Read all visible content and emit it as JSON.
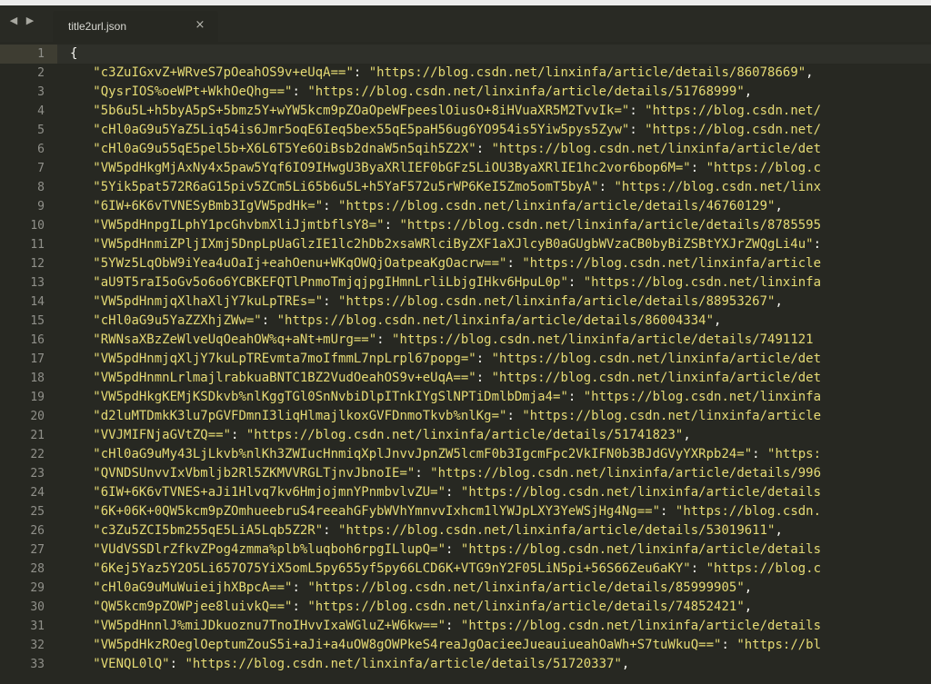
{
  "tabs": [
    {
      "title": "title2url.json"
    }
  ],
  "icons": {
    "nav_back": "◀",
    "nav_forward": "▶",
    "close": "×"
  },
  "colors": {
    "background": "#272822",
    "tabbar": "#292a24",
    "active_line_gutter": "#3e3d32",
    "string": "#e6db74",
    "punctuation": "#f8f8f2",
    "line_number": "#90908a"
  },
  "editor": {
    "first_line": "{",
    "lines": [
      {
        "key": "\"c3ZuIGxvZ+WRveS7pOeahOS9v+eUqA==\"",
        "value": "\"https://blog.csdn.net/linxinfa/article/details/86078669\","
      },
      {
        "key": "\"QysrIOS%oeWPt+WkhOeQhg==\"",
        "value": "\"https://blog.csdn.net/linxinfa/article/details/51768999\","
      },
      {
        "key": "\"5b6u5L+h5byA5pS+5bmz5Y+wYW5kcm9pZOaOpeWFpeeslOiusO+8iHVuaXR5M2TvvIk=\"",
        "value": "\"https://blog.csdn.net/"
      },
      {
        "key": "\"cHl0aG9u5YaZ5Liq54is6Jmr5oqE6Ieq5bex55qE5paH56ug6YO954is5Yiw5pys5Zyw\"",
        "value": "\"https://blog.csdn.net/"
      },
      {
        "key": "\"cHl0aG9u55qE5pel5b+X6L6T5Ye6OiBsb2dnaW5n5qih5Z2X\"",
        "value": "\"https://blog.csdn.net/linxinfa/article/det"
      },
      {
        "key": "\"VW5pdHkgMjAxNy4x5paw5Yqf6IO9IHwgU3ByaXRlIEF0bGFz5LiOU3ByaXRlIE1hc2vor6bop6M=\"",
        "value": "\"https://blog.c"
      },
      {
        "key": "\"5Yik5pat572R6aG15piv5ZCm5Li65b6u5L+h5YaF572u5rWP6KeI5Zmo5omT5byA\"",
        "value": "\"https://blog.csdn.net/linx"
      },
      {
        "key": "\"6IW+6K6vTVNESyBmb3IgVW5pdHk=\"",
        "value": "\"https://blog.csdn.net/linxinfa/article/details/46760129\","
      },
      {
        "key": "\"VW5pdHnpgILphY1pcGhvbmXliJjmtbflsY8=\"",
        "value": "\"https://blog.csdn.net/linxinfa/article/details/8785595"
      },
      {
        "key": "\"VW5pdHnmiZPljIXmj5DnpLpUaGlzIE1lc2hDb2xsaWRlciByZXF1aXJlcyB0aGUgbWVzaCB0byBiZSBtYXJrZWQgLi4u\"",
        "value": ":"
      },
      {
        "key": "\"5YWz5LqObW9iYea4uOaIj+eahOenu+WKqOWQjOatpeaKgOacrw==\"",
        "value": "\"https://blog.csdn.net/linxinfa/article"
      },
      {
        "key": "\"aU9T5raI5oGv5o6o6YCBKEFQTlPnmoTmjqjpgIHmnLrliLbjgIHkv6HpuL0p\"",
        "value": "\"https://blog.csdn.net/linxinfa"
      },
      {
        "key": "\"VW5pdHnmjqXlhaXljY7kuLpTREs=\"",
        "value": "\"https://blog.csdn.net/linxinfa/article/details/88953267\","
      },
      {
        "key": "\"cHl0aG9u5YaZZXhjZWw=\"",
        "value": "\"https://blog.csdn.net/linxinfa/article/details/86004334\","
      },
      {
        "key": "\"RWNsaXBzZeWlveUqOeahOW%q+aNt+mUrg==\"",
        "value": "\"https://blog.csdn.net/linxinfa/article/details/7491121"
      },
      {
        "key": "\"VW5pdHnmjqXljY7kuLpTREvmta7moIfmmL7npLrpl67popg=\"",
        "value": "\"https://blog.csdn.net/linxinfa/article/det"
      },
      {
        "key": "\"VW5pdHnmnLrlmajlrabkuaBNTC1BZ2VudOeahOS9v+eUqA==\"",
        "value": "\"https://blog.csdn.net/linxinfa/article/det"
      },
      {
        "key": "\"VW5pdHkgKEMjKSDkvb%nlKggTGl0SnNvbiDlpITnkIYgSlNPTiDmlbDmja4=\"",
        "value": "\"https://blog.csdn.net/linxinfa"
      },
      {
        "key": "\"d2luMTDmkK3lu7pGVFDmnI3liqHlmajlkoxGVFDnmoTkvb%nlKg=\"",
        "value": "\"https://blog.csdn.net/linxinfa/article"
      },
      {
        "key": "\"VVJMIFNjaGVtZQ==\"",
        "value": "\"https://blog.csdn.net/linxinfa/article/details/51741823\","
      },
      {
        "key": "\"cHl0aG9uMy43LjLkvb%nlKh3ZWIucHnmiqXplJnvvJpnZW5lcmF0b3IgcmFpc2VkIFN0b3BJdGVyYXRpb24=\"",
        "value": "\"https:"
      },
      {
        "key": "\"QVNDSUnvvIxVbmljb2Rl5ZKMVVRGLTjnvJbnoIE=\"",
        "value": "\"https://blog.csdn.net/linxinfa/article/details/996"
      },
      {
        "key": "\"6IW+6K6vTVNES+aJi1Hlvq7kv6HmjojmnYPnmbvlvZU=\"",
        "value": "\"https://blog.csdn.net/linxinfa/article/details"
      },
      {
        "key": "\"6K+06K+0QW5kcm9pZOmhueebruS4reeahGFybWVhYmnvvIxhcm1lYWJpLXY3YeWSjHg4Ng==\"",
        "value": "\"https://blog.csdn."
      },
      {
        "key": "\"c3Zu5ZCI5bm255qE5LiA5Lqb5Z2R\"",
        "value": "\"https://blog.csdn.net/linxinfa/article/details/53019611\","
      },
      {
        "key": "\"VUdVSSDlrZfkvZPog4zmma%plb%luqboh6rpgILlupQ=\"",
        "value": "\"https://blog.csdn.net/linxinfa/article/details"
      },
      {
        "key": "\"6Kej5Yaz5Y2O5Li657O75YiX5omL5py655yf5py66LCD6K+VTG9nY2F05LiN5pi+56S66Zeu6aKY\"",
        "value": "\"https://blog.c"
      },
      {
        "key": "\"cHl0aG9uMuWuieijhXBpcA==\"",
        "value": "\"https://blog.csdn.net/linxinfa/article/details/85999905\","
      },
      {
        "key": "\"QW5kcm9pZOWPjee8luivkQ==\"",
        "value": "\"https://blog.csdn.net/linxinfa/article/details/74852421\","
      },
      {
        "key": "\"VW5pdHnnlJ%miJDkuoznu7TnoIHvvIxaWGluZ+W6kw==\"",
        "value": "\"https://blog.csdn.net/linxinfa/article/details"
      },
      {
        "key": "\"VW5pdHkzROeglOeptumZouS5i+aJi+a4uOW8gOWPkeS4reaJgOacieeJueauiueahOaWh+S7tuWkuQ==\"",
        "value": "\"https://bl"
      },
      {
        "key": "\"VENQL0lQ\"",
        "value": "\"https://blog.csdn.net/linxinfa/article/details/51720337\","
      }
    ]
  }
}
